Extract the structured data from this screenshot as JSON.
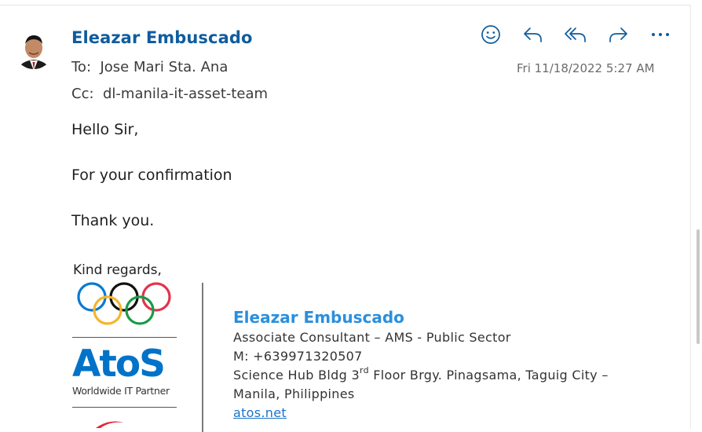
{
  "message": {
    "sender_name": "Eleazar Embuscado",
    "to_prefix": "To:",
    "to": "Jose Mari Sta. Ana",
    "cc_prefix": "Cc:",
    "cc": "dl-manila-it-asset-team",
    "date": "Fri 11/18/2022 5:27 AM",
    "body": {
      "greeting": "Hello Sir,",
      "line1": "For your confirmation",
      "closing": "Thank you."
    }
  },
  "actions": [
    {
      "icon": "smiley-icon",
      "label": "React"
    },
    {
      "icon": "reply-icon",
      "label": "Reply"
    },
    {
      "icon": "reply-all-icon",
      "label": "Reply all"
    },
    {
      "icon": "forward-icon",
      "label": "Forward"
    },
    {
      "icon": "more-icon",
      "label": "More"
    }
  ],
  "signature": {
    "regards": "Kind regards,",
    "logo_text": "AtoS",
    "logo_tagline": "Worldwide IT Partner",
    "name": "Eleazar Embuscado",
    "title": "Associate Consultant – AMS - Public Sector",
    "mobile": "M: +639971320507",
    "address_part1": "Science Hub Bldg 3",
    "address_sup": "rd",
    "address_part2": " Floor Brgy. Pinagsama, Taguig City –",
    "address_line2": "Manila, Philippines",
    "website": "atos.net"
  },
  "colors": {
    "sender": "#0f5c9e",
    "sig_name": "#2a8fde",
    "atos_blue": "#0073c8",
    "link": "#1a73c8"
  }
}
